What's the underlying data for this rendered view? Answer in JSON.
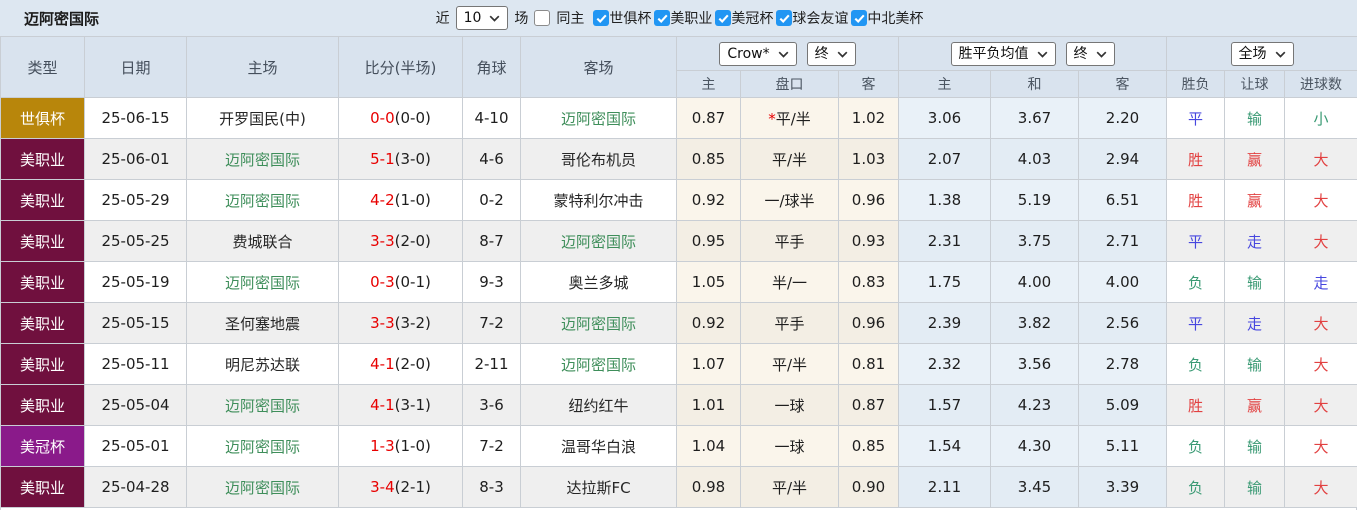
{
  "topbar": {
    "title": "迈阿密国际",
    "recent_label": "近",
    "recent_select": "10",
    "matches_label": "场",
    "same_home": {
      "label": "同主",
      "checked": false
    },
    "leagues": [
      {
        "label": "世俱杯",
        "checked": true
      },
      {
        "label": "美职业",
        "checked": true
      },
      {
        "label": "美冠杯",
        "checked": true
      },
      {
        "label": "球会友谊",
        "checked": true
      },
      {
        "label": "中北美杯",
        "checked": true
      }
    ]
  },
  "table": {
    "header": {
      "type": "类型",
      "date": "日期",
      "home": "主场",
      "score": "比分(半场)",
      "corner": "角球",
      "away": "客场",
      "odds_source_select": "Crow*",
      "odds_time_select": "终",
      "wdl_select": "胜平负均值",
      "wdl_time_select": "终",
      "scope_select": "全场",
      "sub": {
        "home_odds": "主",
        "handicap": "盘口",
        "away_odds": "客",
        "wdl_home": "主",
        "wdl_draw": "和",
        "wdl_away": "客",
        "result": "胜负",
        "handicap_result": "让球",
        "goals": "进球数"
      }
    },
    "type_colors": {
      "世俱杯": "#b8860b",
      "美职业": "#70103e",
      "美冠杯": "#8a1a8a"
    },
    "rows": [
      {
        "type": "世俱杯",
        "date": "25-06-15",
        "home": "开罗国民(中)",
        "home_self": false,
        "score": "0-0",
        "half": "(0-0)",
        "corner": "4-10",
        "away": "迈阿密国际",
        "away_self": true,
        "odds_home": "0.87",
        "handicap_prefix": "*",
        "handicap": "平/半",
        "odds_away": "1.02",
        "wdl_home": "3.06",
        "wdl_draw": "3.67",
        "wdl_away": "2.20",
        "result": {
          "text": "平",
          "color": "blue"
        },
        "handicap_result": {
          "text": "输",
          "color": "green"
        },
        "goals": {
          "text": "小",
          "color": "green"
        }
      },
      {
        "type": "美职业",
        "date": "25-06-01",
        "home": "迈阿密国际",
        "home_self": true,
        "score": "5-1",
        "half": "(3-0)",
        "corner": "4-6",
        "away": "哥伦布机员",
        "away_self": false,
        "odds_home": "0.85",
        "handicap_prefix": "",
        "handicap": "平/半",
        "odds_away": "1.03",
        "wdl_home": "2.07",
        "wdl_draw": "4.03",
        "wdl_away": "2.94",
        "result": {
          "text": "胜",
          "color": "red"
        },
        "handicap_result": {
          "text": "赢",
          "color": "red"
        },
        "goals": {
          "text": "大",
          "color": "red"
        }
      },
      {
        "type": "美职业",
        "date": "25-05-29",
        "home": "迈阿密国际",
        "home_self": true,
        "score": "4-2",
        "half": "(1-0)",
        "corner": "0-2",
        "away": "蒙特利尔冲击",
        "away_self": false,
        "odds_home": "0.92",
        "handicap_prefix": "",
        "handicap": "一/球半",
        "odds_away": "0.96",
        "wdl_home": "1.38",
        "wdl_draw": "5.19",
        "wdl_away": "6.51",
        "result": {
          "text": "胜",
          "color": "red"
        },
        "handicap_result": {
          "text": "赢",
          "color": "red"
        },
        "goals": {
          "text": "大",
          "color": "red"
        }
      },
      {
        "type": "美职业",
        "date": "25-05-25",
        "home": "费城联合",
        "home_self": false,
        "score": "3-3",
        "half": "(2-0)",
        "corner": "8-7",
        "away": "迈阿密国际",
        "away_self": true,
        "odds_home": "0.95",
        "handicap_prefix": "",
        "handicap": "平手",
        "odds_away": "0.93",
        "wdl_home": "2.31",
        "wdl_draw": "3.75",
        "wdl_away": "2.71",
        "result": {
          "text": "平",
          "color": "blue"
        },
        "handicap_result": {
          "text": "走",
          "color": "blue"
        },
        "goals": {
          "text": "大",
          "color": "red"
        }
      },
      {
        "type": "美职业",
        "date": "25-05-19",
        "home": "迈阿密国际",
        "home_self": true,
        "score": "0-3",
        "half": "(0-1)",
        "corner": "9-3",
        "away": "奥兰多城",
        "away_self": false,
        "odds_home": "1.05",
        "handicap_prefix": "",
        "handicap": "半/一",
        "odds_away": "0.83",
        "wdl_home": "1.75",
        "wdl_draw": "4.00",
        "wdl_away": "4.00",
        "result": {
          "text": "负",
          "color": "green"
        },
        "handicap_result": {
          "text": "输",
          "color": "green"
        },
        "goals": {
          "text": "走",
          "color": "blue"
        }
      },
      {
        "type": "美职业",
        "date": "25-05-15",
        "home": "圣何塞地震",
        "home_self": false,
        "score": "3-3",
        "half": "(3-2)",
        "corner": "7-2",
        "away": "迈阿密国际",
        "away_self": true,
        "odds_home": "0.92",
        "handicap_prefix": "",
        "handicap": "平手",
        "odds_away": "0.96",
        "wdl_home": "2.39",
        "wdl_draw": "3.82",
        "wdl_away": "2.56",
        "result": {
          "text": "平",
          "color": "blue"
        },
        "handicap_result": {
          "text": "走",
          "color": "blue"
        },
        "goals": {
          "text": "大",
          "color": "red"
        }
      },
      {
        "type": "美职业",
        "date": "25-05-11",
        "home": "明尼苏达联",
        "home_self": false,
        "score": "4-1",
        "half": "(2-0)",
        "corner": "2-11",
        "away": "迈阿密国际",
        "away_self": true,
        "odds_home": "1.07",
        "handicap_prefix": "",
        "handicap": "平/半",
        "odds_away": "0.81",
        "wdl_home": "2.32",
        "wdl_draw": "3.56",
        "wdl_away": "2.78",
        "result": {
          "text": "负",
          "color": "green"
        },
        "handicap_result": {
          "text": "输",
          "color": "green"
        },
        "goals": {
          "text": "大",
          "color": "red"
        }
      },
      {
        "type": "美职业",
        "date": "25-05-04",
        "home": "迈阿密国际",
        "home_self": true,
        "score": "4-1",
        "half": "(3-1)",
        "corner": "3-6",
        "away": "纽约红牛",
        "away_self": false,
        "odds_home": "1.01",
        "handicap_prefix": "",
        "handicap": "一球",
        "odds_away": "0.87",
        "wdl_home": "1.57",
        "wdl_draw": "4.23",
        "wdl_away": "5.09",
        "result": {
          "text": "胜",
          "color": "red"
        },
        "handicap_result": {
          "text": "赢",
          "color": "red"
        },
        "goals": {
          "text": "大",
          "color": "red"
        }
      },
      {
        "type": "美冠杯",
        "date": "25-05-01",
        "home": "迈阿密国际",
        "home_self": true,
        "score": "1-3",
        "half": "(1-0)",
        "corner": "7-2",
        "away": "温哥华白浪",
        "away_self": false,
        "odds_home": "1.04",
        "handicap_prefix": "",
        "handicap": "一球",
        "odds_away": "0.85",
        "wdl_home": "1.54",
        "wdl_draw": "4.30",
        "wdl_away": "5.11",
        "result": {
          "text": "负",
          "color": "green"
        },
        "handicap_result": {
          "text": "输",
          "color": "green"
        },
        "goals": {
          "text": "大",
          "color": "red"
        }
      },
      {
        "type": "美职业",
        "date": "25-04-28",
        "home": "迈阿密国际",
        "home_self": true,
        "score": "3-4",
        "half": "(2-1)",
        "corner": "8-3",
        "away": "达拉斯FC",
        "away_self": false,
        "odds_home": "0.98",
        "handicap_prefix": "",
        "handicap": "平/半",
        "odds_away": "0.90",
        "wdl_home": "2.11",
        "wdl_draw": "3.45",
        "wdl_away": "3.39",
        "result": {
          "text": "负",
          "color": "green"
        },
        "handicap_result": {
          "text": "输",
          "color": "green"
        },
        "goals": {
          "text": "大",
          "color": "red"
        }
      }
    ]
  },
  "colors": {
    "checkbox_blue": "#2196f3",
    "team_green": "#3e8e5a",
    "team_default": "#262626",
    "score_red": "#e80000",
    "red": "#e24141",
    "blue": "#4747df",
    "green": "#3a9a74"
  }
}
